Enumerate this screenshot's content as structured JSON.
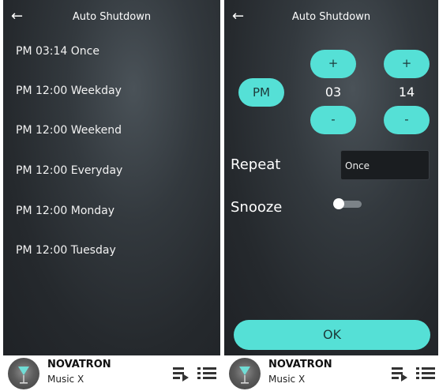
{
  "left_screen": {
    "title": "Auto Shutdown",
    "back_icon": "←",
    "items": [
      {
        "label": "PM 03:14 Once"
      },
      {
        "label": "PM 12:00 Weekday"
      },
      {
        "label": "PM 12:00 Weekend"
      },
      {
        "label": "PM 12:00 Everyday"
      },
      {
        "label": "PM 12:00 Monday"
      },
      {
        "label": "PM 12:00 Tuesday"
      }
    ]
  },
  "right_screen": {
    "title": "Auto Shutdown",
    "back_icon": "←",
    "ampm": "PM",
    "hour": "03",
    "minute": "14",
    "plus_label": "+",
    "minus_label": "-",
    "repeat_label": "Repeat",
    "repeat_value": "Once",
    "snooze_label": "Snooze",
    "snooze_on": false,
    "ok_label": "OK"
  },
  "player": {
    "artist": "NOVATRON",
    "track": "Music X",
    "icons": [
      "album-art-icon",
      "queue-music-icon",
      "list-icon"
    ]
  },
  "colors": {
    "accent": "#55e0d6",
    "background": "#2c3136"
  }
}
